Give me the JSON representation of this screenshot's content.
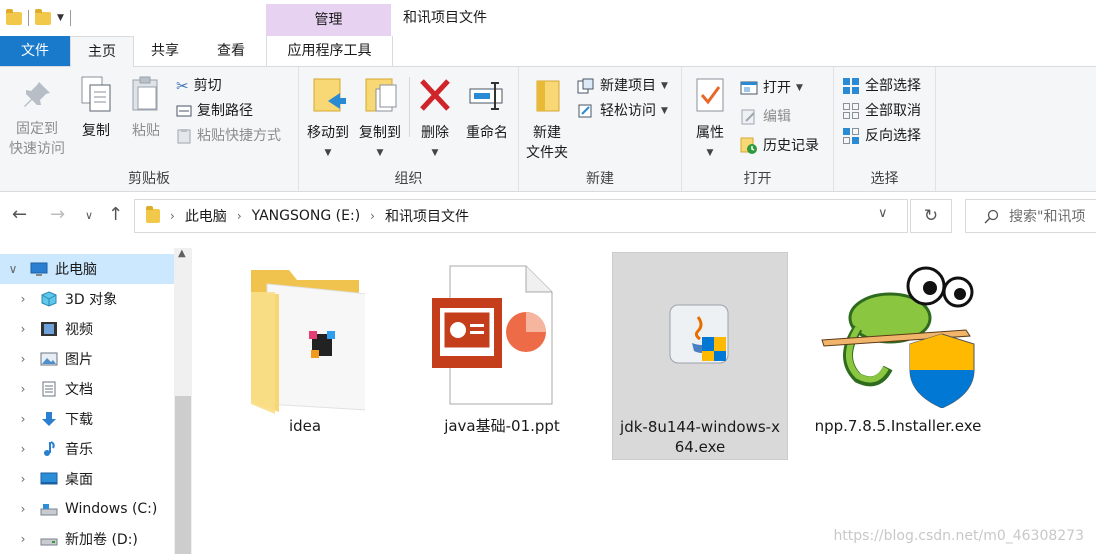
{
  "window": {
    "title": "和讯项目文件",
    "context_tab": "管理"
  },
  "ribbon_tabs": {
    "file": "文件",
    "home": "主页",
    "share": "共享",
    "view": "查看",
    "manage_tools": "应用程序工具"
  },
  "ribbon": {
    "clipboard": {
      "label": "剪贴板",
      "pin_line1": "固定到",
      "pin_line2": "快速访问",
      "copy": "复制",
      "paste": "粘贴",
      "cut": "剪切",
      "copy_path": "复制路径",
      "paste_shortcut": "粘贴快捷方式"
    },
    "organize": {
      "label": "组织",
      "move_to": "移动到",
      "copy_to": "复制到",
      "delete": "删除",
      "rename": "重命名"
    },
    "new": {
      "label": "新建",
      "new_folder_line1": "新建",
      "new_folder_line2": "文件夹",
      "new_item": "新建项目",
      "easy_access": "轻松访问"
    },
    "open": {
      "label": "打开",
      "properties": "属性",
      "open": "打开",
      "edit": "编辑",
      "history": "历史记录"
    },
    "select": {
      "label": "选择",
      "select_all": "全部选择",
      "select_none": "全部取消",
      "invert": "反向选择"
    }
  },
  "address": {
    "segments": [
      "此电脑",
      "YANGSONG (E:)",
      "和讯项目文件"
    ],
    "search_placeholder": "搜索\"和讯项"
  },
  "nav": {
    "items": [
      {
        "label": "此电脑",
        "icon": "computer-icon"
      },
      {
        "label": "3D 对象",
        "icon": "cube-3d-icon"
      },
      {
        "label": "视频",
        "icon": "video-icon"
      },
      {
        "label": "图片",
        "icon": "picture-icon"
      },
      {
        "label": "文档",
        "icon": "document-icon"
      },
      {
        "label": "下载",
        "icon": "download-icon"
      },
      {
        "label": "音乐",
        "icon": "music-icon"
      },
      {
        "label": "桌面",
        "icon": "desktop-icon"
      },
      {
        "label": "Windows (C:)",
        "icon": "drive-icon"
      },
      {
        "label": "新加卷 (D:)",
        "icon": "drive-icon"
      }
    ]
  },
  "files": [
    {
      "name": "idea",
      "icon": "folder-icon"
    },
    {
      "name": "java基础-01.ppt",
      "icon": "powerpoint-icon"
    },
    {
      "name_line1": "jdk-8u144-windows-x",
      "name_line2": "64.exe",
      "icon": "java-installer-icon",
      "selected": true
    },
    {
      "name": "npp.7.8.5.Installer.exe",
      "icon": "notepad-plus-plus-icon"
    }
  ],
  "watermark": "https://blog.csdn.net/m0_46308273",
  "colors": {
    "file_tab": "#1979ca",
    "context_tab": "#e7d2f2",
    "nav_selected": "#cce8ff",
    "ribbon_bg": "#f5f6f7"
  }
}
